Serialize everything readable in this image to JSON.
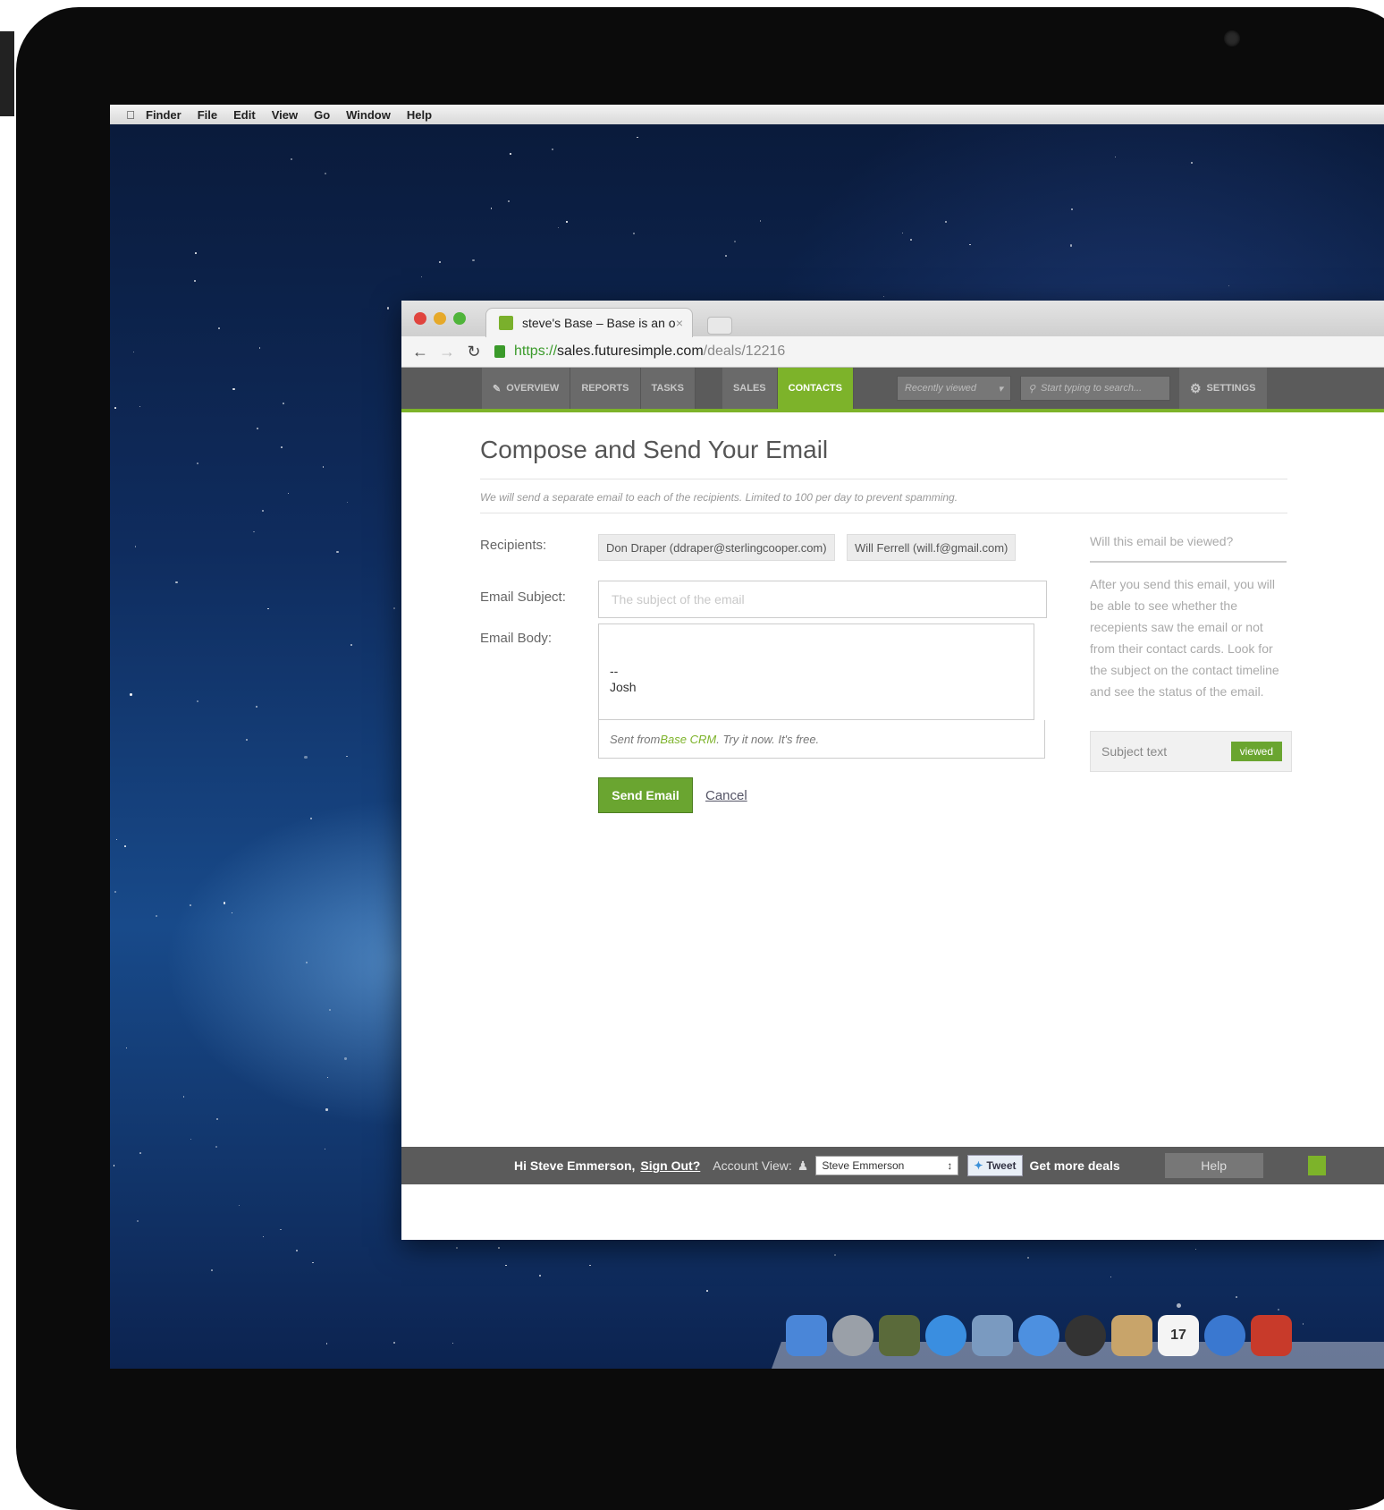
{
  "os": {
    "menubar": [
      "Finder",
      "File",
      "Edit",
      "View",
      "Go",
      "Window",
      "Help"
    ]
  },
  "browser": {
    "tab_title": "steve's Base – Base is an on",
    "tab_close": "×",
    "url": {
      "protocol": "https://",
      "domain": "sales.futuresimple.com",
      "path": "/deals/12216"
    }
  },
  "app": {
    "nav": {
      "overview": "OVERVIEW",
      "reports": "REPORTS",
      "tasks": "TASKS",
      "sales": "SALES",
      "contacts": "CONTACTS",
      "recently_viewed": "Recently viewed",
      "search_placeholder": "Start typing to search...",
      "settings": "SETTINGS"
    },
    "page_title": "Compose and Send Your Email",
    "notice": "We will send a separate email to each of the recipients. Limited to 100 per day to prevent spamming.",
    "form": {
      "recipients_label": "Recipients:",
      "recipients": [
        "Don Draper (ddraper@sterlingcooper.com)",
        "Will Ferrell (will.f@gmail.com)"
      ],
      "subject_label": "Email Subject:",
      "subject_placeholder": "The subject of the email",
      "body_label": "Email Body:",
      "body_sig_dash": "--",
      "body_sig_name": "Josh",
      "sent_from_prefix": "Sent from ",
      "sent_from_link": "Base CRM",
      "sent_from_suffix": ". Try it now. It's free.",
      "send_button": "Send Email",
      "cancel": "Cancel"
    },
    "sidebar": {
      "question": "Will this email be viewed?",
      "text": "After you send this email, you will be able to see whether the recepients saw the email or not from their contact cards. Look for the subject on the contact timeline and see the status of the email.",
      "example_subject": "Subject text",
      "example_status": "viewed"
    },
    "footer": {
      "greeting": "Hi Steve Emmerson,",
      "sign_out": "Sign Out?",
      "account_view": "Account View:",
      "account_selected": "Steve Emmerson",
      "tweet": "Tweet",
      "more_deals": "Get more deals",
      "help": "Help"
    }
  },
  "dock": {
    "calendar_day": "17"
  },
  "colors": {
    "accent_green": "#7db32a",
    "nav_gray": "#5b5b5b"
  }
}
